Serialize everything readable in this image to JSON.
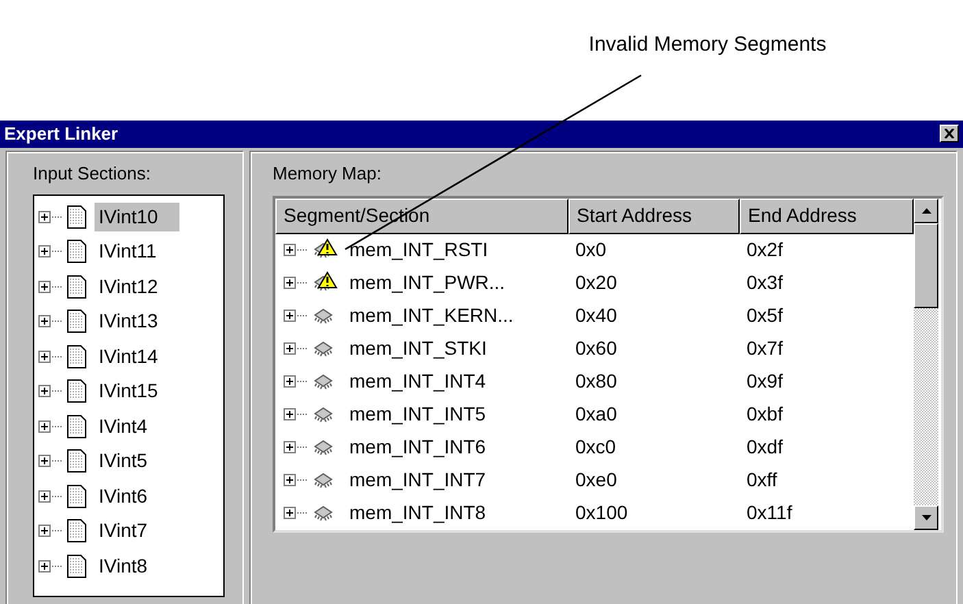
{
  "annotation": "Invalid Memory Segments",
  "window": {
    "title": "Expert Linker"
  },
  "input_sections": {
    "label": "Input Sections:",
    "items": [
      {
        "name": "IVint10",
        "selected": true
      },
      {
        "name": "IVint11",
        "selected": false
      },
      {
        "name": "IVint12",
        "selected": false
      },
      {
        "name": "IVint13",
        "selected": false
      },
      {
        "name": "IVint14",
        "selected": false
      },
      {
        "name": "IVint15",
        "selected": false
      },
      {
        "name": "IVint4",
        "selected": false
      },
      {
        "name": "IVint5",
        "selected": false
      },
      {
        "name": "IVint6",
        "selected": false
      },
      {
        "name": "IVint7",
        "selected": false
      },
      {
        "name": "IVint8",
        "selected": false
      }
    ]
  },
  "memory_map": {
    "label": "Memory Map:",
    "columns": [
      "Segment/Section",
      "Start Address",
      "End Address"
    ],
    "rows": [
      {
        "segment": "mem_INT_RSTI",
        "start": "0x0",
        "end": "0x2f",
        "warning": true
      },
      {
        "segment": "mem_INT_PWR...",
        "start": "0x20",
        "end": "0x3f",
        "warning": true
      },
      {
        "segment": "mem_INT_KERN...",
        "start": "0x40",
        "end": "0x5f",
        "warning": false
      },
      {
        "segment": "mem_INT_STKI",
        "start": "0x60",
        "end": "0x7f",
        "warning": false
      },
      {
        "segment": "mem_INT_INT4",
        "start": "0x80",
        "end": "0x9f",
        "warning": false
      },
      {
        "segment": "mem_INT_INT5",
        "start": "0xa0",
        "end": "0xbf",
        "warning": false
      },
      {
        "segment": "mem_INT_INT6",
        "start": "0xc0",
        "end": "0xdf",
        "warning": false
      },
      {
        "segment": "mem_INT_INT7",
        "start": "0xe0",
        "end": "0xff",
        "warning": false
      },
      {
        "segment": "mem_INT_INT8",
        "start": "0x100",
        "end": "0x11f",
        "warning": false
      }
    ]
  }
}
